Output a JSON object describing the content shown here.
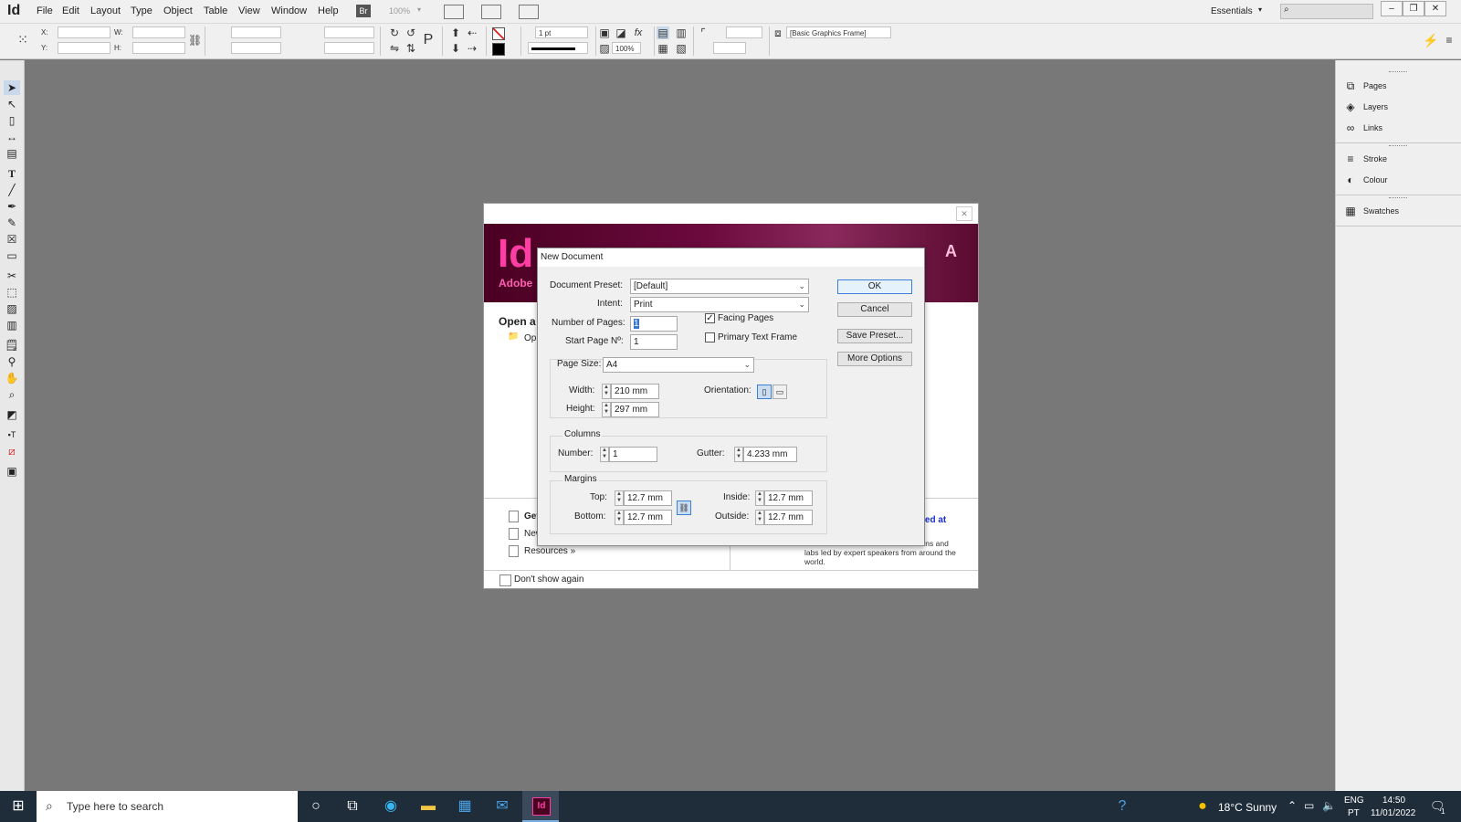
{
  "menubar": {
    "logo": "Id",
    "items": [
      "File",
      "Edit",
      "Layout",
      "Type",
      "Object",
      "Table",
      "View",
      "Window",
      "Help"
    ],
    "br_badge": "Br",
    "zoom": "100%",
    "workspace": "Essentials",
    "search_placeholder": ""
  },
  "controlbar": {
    "x_label": "X:",
    "y_label": "Y:",
    "w_label": "W:",
    "h_label": "H:",
    "stroke_weight": "1 pt",
    "percent": "100%",
    "object_style": "[Basic Graphics Frame]"
  },
  "rightpanel": {
    "items": [
      "Pages",
      "Layers",
      "Links",
      "Stroke",
      "Colour",
      "Swatches"
    ]
  },
  "welcome": {
    "logo": "Id",
    "adobe": "Adobe",
    "open_heading": "Open a",
    "open_item": "Op",
    "links": [
      "Get",
      "New",
      "Resources »"
    ],
    "featured": "red at",
    "promo": "Choose from more than 300 sessions and labs led by expert speakers from around the world.",
    "dont_show": "Don't show again"
  },
  "dialog": {
    "title": "New Document",
    "preset_label": "Document Preset:",
    "preset_value": "[Default]",
    "intent_label": "Intent:",
    "intent_value": "Print",
    "pages_label": "Number of Pages:",
    "pages_value": "1",
    "start_label": "Start Page Nº:",
    "start_value": "1",
    "facing_label": "Facing Pages",
    "facing_checked": true,
    "primary_label": "Primary Text Frame",
    "primary_checked": false,
    "size_label": "Page Size:",
    "size_value": "A4",
    "width_label": "Width:",
    "width_value": "210 mm",
    "height_label": "Height:",
    "height_value": "297 mm",
    "orientation_label": "Orientation:",
    "columns_title": "Columns",
    "number_label": "Number:",
    "number_value": "1",
    "gutter_label": "Gutter:",
    "gutter_value": "4.233 mm",
    "margins_title": "Margins",
    "top_label": "Top:",
    "top_value": "12.7 mm",
    "bottom_label": "Bottom:",
    "bottom_value": "12.7 mm",
    "inside_label": "Inside:",
    "inside_value": "12.7 mm",
    "outside_label": "Outside:",
    "outside_value": "12.7 mm",
    "buttons": {
      "ok": "OK",
      "cancel": "Cancel",
      "save_preset": "Save Preset...",
      "more_options": "More Options"
    }
  },
  "taskbar": {
    "search_placeholder": "Type here to search",
    "weather": "18°C  Sunny",
    "lang_top": "ENG",
    "lang_bottom": "PT",
    "time": "14:50",
    "date": "11/01/2022",
    "notifications": "1"
  }
}
